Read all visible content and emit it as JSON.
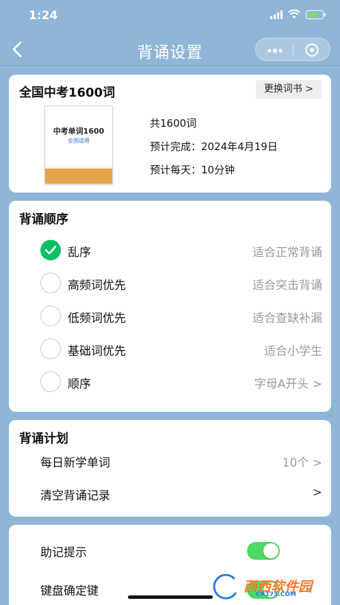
{
  "status": {
    "time": "1:24"
  },
  "nav": {
    "title": "背诵设置"
  },
  "book": {
    "name": "全国中考1600词",
    "change_label": "更换词书 >",
    "cover_title": "中考单词1600",
    "cover_subtitle": "全国适用",
    "total": "共1600词",
    "finish": "预计完成：2024年4月19日",
    "daily": "预计每天：10分钟"
  },
  "order": {
    "title": "背诵顺序",
    "options": [
      {
        "label": "乱序",
        "desc": "适合正常背诵",
        "checked": true
      },
      {
        "label": "高频词优先",
        "desc": "适合突击背诵",
        "checked": false
      },
      {
        "label": "低频词优先",
        "desc": "适合查缺补漏",
        "checked": false
      },
      {
        "label": "基础词优先",
        "desc": "适合小学生",
        "checked": false
      },
      {
        "label": "顺序",
        "desc": "字母A开头 >",
        "checked": false
      }
    ]
  },
  "plan": {
    "title": "背诵计划",
    "daily_new_label": "每日新学单词",
    "daily_new_value": "10个 >",
    "clear_label": "清空背诵记录",
    "clear_value": ">"
  },
  "extra": {
    "mnemonic_label": "助记提示",
    "mnemonic_on": true,
    "enter_key_label": "键盘确定键",
    "enter_key_on": true
  },
  "watermark": {
    "text": "西西软件园",
    "sub": "CR173.COM"
  },
  "colors": {
    "accent_green": "#07c160",
    "toggle_green": "#4cd964",
    "background": "#8fb6d6"
  }
}
